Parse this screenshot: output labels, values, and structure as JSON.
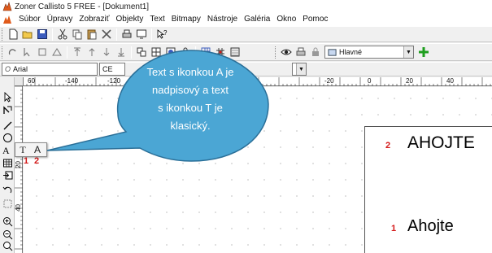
{
  "window": {
    "title": "Zoner Callisto 5 FREE - [Dokument1]"
  },
  "menu": [
    "Súbor",
    "Úpravy",
    "Zobraziť",
    "Objekty",
    "Text",
    "Bitmapy",
    "Nástroje",
    "Galéria",
    "Okno",
    "Pomoc"
  ],
  "toolbar3": {
    "font_name": "Arial",
    "encoding": "CE"
  },
  "toolbar2": {
    "view_mode": "Hlavné"
  },
  "ruler": {
    "h_labels": [
      "60",
      "-140",
      "-120",
      "-20",
      "0",
      "20",
      "40"
    ],
    "v_labels": [
      "20",
      "40"
    ]
  },
  "callout": {
    "lines": [
      "Text s ikonkou A je",
      "nadpisový a text",
      "s ikonkou T je",
      "klasický."
    ],
    "fill_color": "#4ba6d4",
    "border_color": "#2a6f98"
  },
  "flyout": {
    "plain_text_icon": "T",
    "artistic_text_icon": "A"
  },
  "annotations": {
    "one": "1",
    "two": "2"
  },
  "canvas_text": {
    "heading": "AHOJTE",
    "regular": "Ahojte"
  },
  "colors": {
    "annotation_red": "#d41a1a",
    "accent_green": "#1e9e1e"
  }
}
